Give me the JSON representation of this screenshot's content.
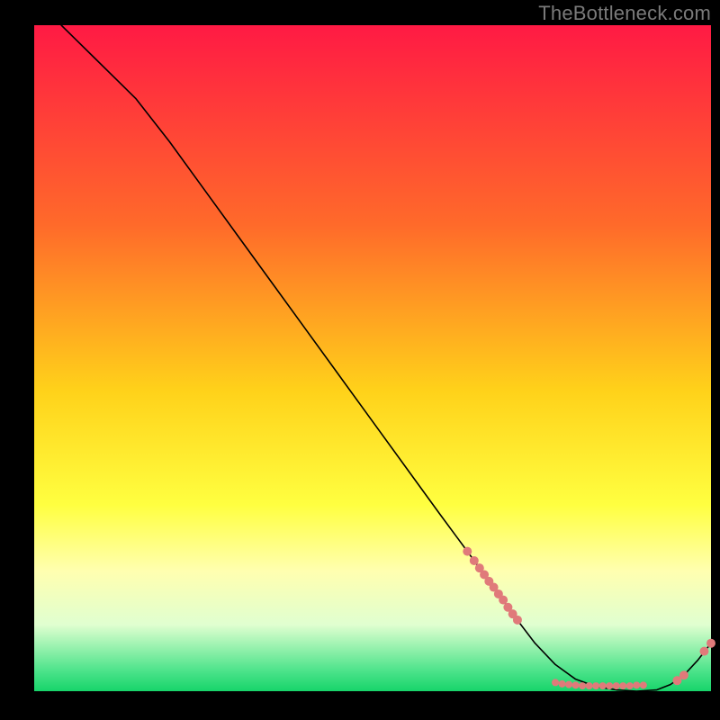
{
  "watermark": "TheBottleneck.com",
  "chart_data": {
    "type": "line",
    "title": "",
    "xlabel": "",
    "ylabel": "",
    "xlim": [
      0,
      100
    ],
    "ylim": [
      0,
      100
    ],
    "grid": false,
    "legend": false,
    "background": {
      "type": "vertical-gradient",
      "stops": [
        {
          "pos": 0.0,
          "color": "#ff1a44"
        },
        {
          "pos": 0.3,
          "color": "#ff6a2a"
        },
        {
          "pos": 0.55,
          "color": "#ffd21a"
        },
        {
          "pos": 0.72,
          "color": "#ffff40"
        },
        {
          "pos": 0.82,
          "color": "#ffffb0"
        },
        {
          "pos": 0.9,
          "color": "#e0ffd0"
        },
        {
          "pos": 0.97,
          "color": "#4be38a"
        },
        {
          "pos": 1.0,
          "color": "#17d46a"
        }
      ]
    },
    "series": [
      {
        "name": "curve",
        "type": "line",
        "color": "#000000",
        "stroke_width": 1.6,
        "x": [
          4,
          6,
          9,
          12,
          15,
          20,
          25,
          30,
          35,
          40,
          45,
          50,
          55,
          60,
          64,
          68,
          71,
          74,
          77,
          80,
          83,
          86,
          89,
          92,
          94,
          96,
          98,
          100
        ],
        "y": [
          100,
          98,
          95,
          92,
          89,
          82.5,
          75.5,
          68.5,
          61.5,
          54.5,
          47.5,
          40.5,
          33.5,
          26.5,
          21,
          15.4,
          11.2,
          7.2,
          4.0,
          1.8,
          0.7,
          0.2,
          0.0,
          0.2,
          1.0,
          2.4,
          4.6,
          7.2
        ]
      },
      {
        "name": "dots-descent",
        "type": "scatter",
        "color": "#e07a7a",
        "radius": 5,
        "x": [
          64.0,
          65.0,
          65.8,
          66.5,
          67.2,
          67.9,
          68.6,
          69.3,
          70.0,
          70.7,
          71.4
        ],
        "y": [
          21.0,
          19.6,
          18.5,
          17.5,
          16.5,
          15.6,
          14.6,
          13.7,
          12.6,
          11.6,
          10.7
        ]
      },
      {
        "name": "dots-bottom",
        "type": "scatter",
        "color": "#e07a7a",
        "radius": 4,
        "x": [
          77.0,
          78.0,
          79.0,
          80.0,
          81.0,
          82.0,
          83.0,
          84.0,
          85.0,
          86.0,
          87.0,
          88.0,
          89.0,
          90.0
        ],
        "y": [
          1.3,
          1.1,
          1.0,
          0.9,
          0.8,
          0.8,
          0.8,
          0.8,
          0.8,
          0.8,
          0.8,
          0.8,
          0.9,
          0.9
        ]
      },
      {
        "name": "dots-ascent",
        "type": "scatter",
        "color": "#e07a7a",
        "radius": 5,
        "x": [
          95.0,
          96.0,
          99.0,
          100.0
        ],
        "y": [
          1.6,
          2.4,
          6.0,
          7.2
        ]
      }
    ]
  }
}
